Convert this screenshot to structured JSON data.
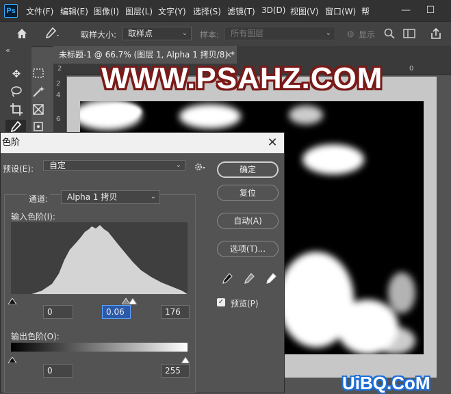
{
  "app": {
    "logo": "Ps"
  },
  "menu": [
    "文件(F)",
    "编辑(E)",
    "图像(I)",
    "图层(L)",
    "文字(Y)",
    "选择(S)",
    "滤镜(T)",
    "3D(D)",
    "视图(V)",
    "窗口(W)",
    "帮"
  ],
  "window_controls": {
    "minimize": "—",
    "restore": "☐"
  },
  "options_bar": {
    "sample_size_label": "取样大小:",
    "sample_size_value": "取样点",
    "sample_label": "样本:",
    "sample_value": "所有图层",
    "show_label": "显示",
    "collapse": "«"
  },
  "document": {
    "tab_title": "未标题-1 @ 66.7% (图层 1, Alpha 1 拷贝/8) *",
    "tab_close": "×",
    "ruler_top": [
      "2",
      "0"
    ],
    "ruler_left": [
      "2",
      "4",
      "6"
    ]
  },
  "watermarks": {
    "top": "WWW.PSAHZ.COM",
    "bottom": "UiBQ.CoM"
  },
  "levels_dialog": {
    "title": "色阶",
    "close": "✕",
    "preset_label": "预设(E):",
    "preset_value": "自定",
    "channel_label": "通道:",
    "channel_value": "Alpha 1 拷贝",
    "input_levels_label": "输入色阶(I):",
    "input_black": "0",
    "input_mid": "0.06",
    "input_white": "176",
    "output_levels_label": "输出色阶(O):",
    "output_black": "0",
    "output_white": "255",
    "buttons": {
      "ok": "确定",
      "reset": "复位",
      "auto": "自动(A)",
      "options": "选项(T)..."
    },
    "preview_label": "预览(P)",
    "preview_checked": true
  }
}
